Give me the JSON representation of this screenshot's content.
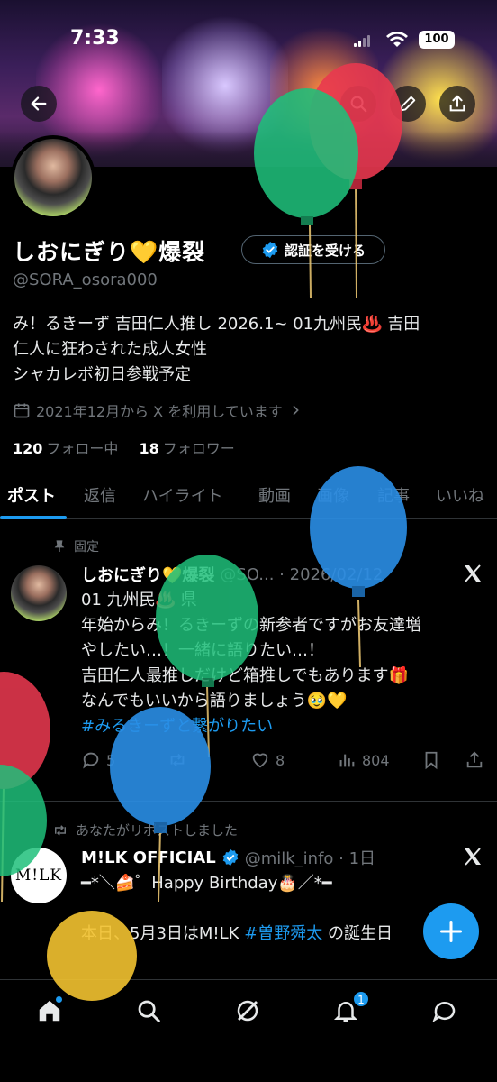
{
  "status_bar": {
    "time": "7:33",
    "battery": "100"
  },
  "profile": {
    "name": "しおにぎり💛爆裂",
    "verify_button": "認証を受ける",
    "handle": "@SORA_osora000",
    "bio_line1": "み！るきーず 吉田仁人推し 2026.1~ 01九州民♨️ 吉田",
    "bio_line2": "仁人に狂わされた成人女性",
    "bio_line3": "シャカレボ初日参戦予定",
    "joined": "2021年12月から X を利用しています",
    "following_count": "120",
    "following_label": "フォロー中",
    "followers_count": "18",
    "followers_label": "フォロワー"
  },
  "tabs": [
    "ポスト",
    "返信",
    "ハイライト",
    "動画",
    "画像",
    "記事",
    "いいね"
  ],
  "pinned_post": {
    "pin_label": "固定",
    "author": "しおにぎり💛爆裂",
    "meta": "@SO... · 2026/02/12",
    "lines": [
      "01 九州民♨️ 県",
      "年始からみ！るきーずの新参者ですがお友達増",
      "やしたい…！一緒に語りたい…！",
      "吉田仁人最推しだけど箱推しでもあります🎁",
      "なんでもいいから語りましょう🥹💛"
    ],
    "hashtag": "#みるきーずと繋がりたい",
    "replies": "5",
    "likes": "8",
    "views": "804"
  },
  "repost": {
    "repost_label": "あなたがリポストしました",
    "avatar_text": "M!LK",
    "author": "M!LK OFFICIAL",
    "meta": "@milk_info · 1日",
    "line1": "━*＼🍰゜Happy Birthday🎂／*━",
    "line2_prefix": "本日、5月3日はM!LK ",
    "line2_hashtag": "#曽野舜太",
    "line2_suffix": " の誕生日"
  },
  "colors": {
    "accent": "#1d9bf0",
    "background": "#000000",
    "muted": "#71767b"
  },
  "icons": [
    "back-arrow-icon",
    "search-icon",
    "edit-icon",
    "share-icon",
    "calendar-icon",
    "pin-icon",
    "x-logo-icon",
    "reply-icon",
    "repost-icon",
    "like-icon",
    "views-icon",
    "bookmark-icon",
    "compose-icon",
    "home-icon",
    "grok-icon",
    "notifications-icon",
    "messages-icon"
  ],
  "nav": {
    "notification_count": "1"
  }
}
